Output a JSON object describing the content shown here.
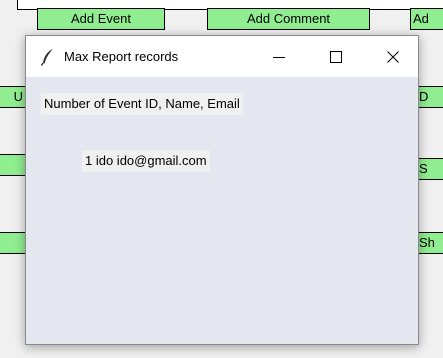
{
  "background_window": {
    "buttons": {
      "add_event": "Add Event",
      "add_comment": "Add Comment",
      "add_clipped": "Ad",
      "left_clip_1": "U",
      "right_clip_1": "D",
      "right_clip_2": "S",
      "right_clip_3": "Sh"
    },
    "button_color": "#90ee90"
  },
  "popup": {
    "title": "Max Report records",
    "app_icon": "feather-icon",
    "controls": {
      "minimize_icon": "minimize-icon",
      "maximize_icon": "maximize-icon",
      "close_icon": "close-icon"
    },
    "header": "Number of Event ID, Name, Email",
    "record": "1 ido ido@gmail.com"
  }
}
